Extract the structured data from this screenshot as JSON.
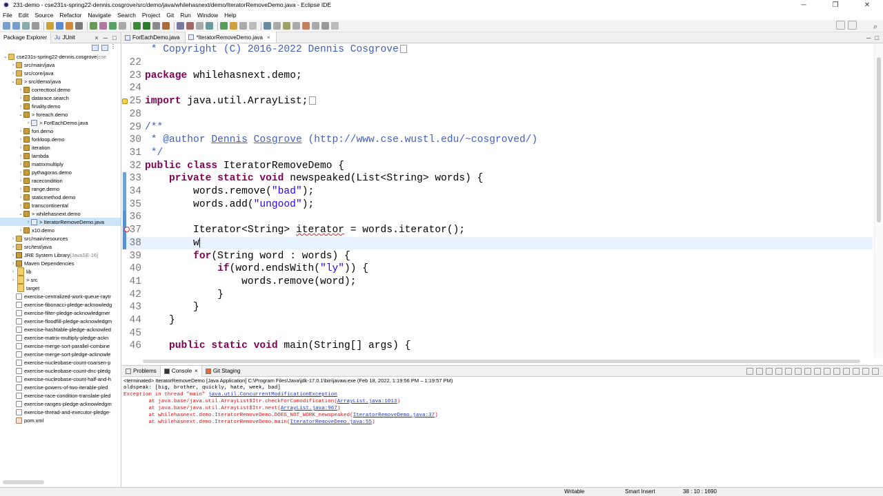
{
  "window": {
    "title": "231-demo - cse231s-spring22-dennis.cosgrove/src/demo/java/whilehasnext/demo/IteratorRemoveDemo.java - Eclipse IDE"
  },
  "menu": [
    "File",
    "Edit",
    "Source",
    "Refactor",
    "Navigate",
    "Search",
    "Project",
    "Git",
    "Run",
    "Window",
    "Help"
  ],
  "left_panel": {
    "tabs": [
      "Package Explorer",
      "JUnit"
    ],
    "tree": [
      {
        "indent": 0,
        "arrow": "⌄",
        "icon": "proj",
        "label": "cse231s-spring22-dennis.cosgrove",
        "dec": " [cse"
      },
      {
        "indent": 1,
        "arrow": "›",
        "icon": "srcf",
        "label": "src/main/java",
        "dec": ""
      },
      {
        "indent": 1,
        "arrow": "›",
        "icon": "srcf",
        "label": "src/core/java",
        "dec": ""
      },
      {
        "indent": 1,
        "arrow": "⌄",
        "icon": "srcf",
        "label": "> src/demo/java",
        "dec": ""
      },
      {
        "indent": 2,
        "arrow": "›",
        "icon": "pkg",
        "label": "correcttool.demo",
        "dec": ""
      },
      {
        "indent": 2,
        "arrow": "›",
        "icon": "pkg",
        "label": "datarace.search",
        "dec": ""
      },
      {
        "indent": 2,
        "arrow": "›",
        "icon": "pkg",
        "label": "finality.demo",
        "dec": ""
      },
      {
        "indent": 2,
        "arrow": "⌄",
        "icon": "pkg",
        "label": "> foreach.demo",
        "dec": ""
      },
      {
        "indent": 3,
        "arrow": "›",
        "icon": "java",
        "label": "> ForEachDemo.java",
        "dec": ""
      },
      {
        "indent": 2,
        "arrow": "›",
        "icon": "pkg",
        "label": "fori.demo",
        "dec": ""
      },
      {
        "indent": 2,
        "arrow": "›",
        "icon": "pkg",
        "label": "forkloop.demo",
        "dec": ""
      },
      {
        "indent": 2,
        "arrow": "›",
        "icon": "pkg",
        "label": "iteration",
        "dec": ""
      },
      {
        "indent": 2,
        "arrow": "›",
        "icon": "pkg",
        "label": "lambda",
        "dec": ""
      },
      {
        "indent": 2,
        "arrow": "›",
        "icon": "pkg",
        "label": "matrixmultiply",
        "dec": ""
      },
      {
        "indent": 2,
        "arrow": "›",
        "icon": "pkg",
        "label": "pythagoras.demo",
        "dec": ""
      },
      {
        "indent": 2,
        "arrow": "›",
        "icon": "pkg",
        "label": "racecondition",
        "dec": ""
      },
      {
        "indent": 2,
        "arrow": "›",
        "icon": "pkg",
        "label": "range.demo",
        "dec": ""
      },
      {
        "indent": 2,
        "arrow": "›",
        "icon": "pkg",
        "label": "staticmethod.demo",
        "dec": ""
      },
      {
        "indent": 2,
        "arrow": "›",
        "icon": "pkg",
        "label": "transcontinental",
        "dec": ""
      },
      {
        "indent": 2,
        "arrow": "⌄",
        "icon": "pkg",
        "label": "> whilehasnext.demo",
        "dec": ""
      },
      {
        "indent": 3,
        "arrow": "›",
        "icon": "java",
        "label": "> IteratorRemoveDemo.java",
        "dec": "",
        "sel": true
      },
      {
        "indent": 2,
        "arrow": "›",
        "icon": "pkg",
        "label": "x10.demo",
        "dec": ""
      },
      {
        "indent": 1,
        "arrow": "›",
        "icon": "srcf",
        "label": "src/main/resources",
        "dec": ""
      },
      {
        "indent": 1,
        "arrow": "›",
        "icon": "srcf",
        "label": "src/test/java",
        "dec": ""
      },
      {
        "indent": 1,
        "arrow": "›",
        "icon": "jar",
        "label": "JRE System Library",
        "dec": " [JavaSE-16]"
      },
      {
        "indent": 1,
        "arrow": "›",
        "icon": "jar",
        "label": "Maven Dependencies",
        "dec": ""
      },
      {
        "indent": 1,
        "arrow": "›",
        "icon": "fold",
        "label": "lib",
        "dec": ""
      },
      {
        "indent": 1,
        "arrow": "›",
        "icon": "fold",
        "label": "> src",
        "dec": ""
      },
      {
        "indent": 1,
        "arrow": "",
        "icon": "fold",
        "label": "target",
        "dec": ""
      },
      {
        "indent": 1,
        "arrow": "",
        "icon": "file",
        "label": "exercise-centralized-work-queue-raytr",
        "dec": ""
      },
      {
        "indent": 1,
        "arrow": "",
        "icon": "file",
        "label": "exercise-fibonacci-pledge-acknowledg",
        "dec": ""
      },
      {
        "indent": 1,
        "arrow": "",
        "icon": "file",
        "label": "exercise-filter-pledge-acknowledgmer",
        "dec": ""
      },
      {
        "indent": 1,
        "arrow": "",
        "icon": "file",
        "label": "exercise-floodfill-pledge-acknowledgm",
        "dec": ""
      },
      {
        "indent": 1,
        "arrow": "",
        "icon": "file",
        "label": "exercise-hashtable-pledge-acknowled",
        "dec": ""
      },
      {
        "indent": 1,
        "arrow": "",
        "icon": "file",
        "label": "exercise-matrix-multiply-pledge-ackn",
        "dec": ""
      },
      {
        "indent": 1,
        "arrow": "",
        "icon": "file",
        "label": "exercise-merge-sort-parallel-combine",
        "dec": ""
      },
      {
        "indent": 1,
        "arrow": "",
        "icon": "file",
        "label": "exercise-merge-sort-pledge-acknowle",
        "dec": ""
      },
      {
        "indent": 1,
        "arrow": "",
        "icon": "file",
        "label": "exercise-nucleobase-count-coarsen-p",
        "dec": ""
      },
      {
        "indent": 1,
        "arrow": "",
        "icon": "file",
        "label": "exercise-nucleobase-count-dnc-pledg",
        "dec": ""
      },
      {
        "indent": 1,
        "arrow": "",
        "icon": "file",
        "label": "exercise-nucleobase-count-half-and-h",
        "dec": ""
      },
      {
        "indent": 1,
        "arrow": "",
        "icon": "file",
        "label": "exercise-powers-of-two-iterable-pled",
        "dec": ""
      },
      {
        "indent": 1,
        "arrow": "",
        "icon": "file",
        "label": "exercise-race-condition-translate-pled",
        "dec": ""
      },
      {
        "indent": 1,
        "arrow": "",
        "icon": "file",
        "label": "exercise-ranges-pledge-acknowledgm",
        "dec": ""
      },
      {
        "indent": 1,
        "arrow": "",
        "icon": "file",
        "label": "exercise-thread-and-executor-pledge-",
        "dec": ""
      },
      {
        "indent": 1,
        "arrow": "",
        "icon": "xml",
        "label": "pom.xml",
        "dec": ""
      }
    ]
  },
  "editor": {
    "tabs": [
      "ForEachDemo.java",
      "*IteratorRemoveDemo.java"
    ],
    "lines": [
      {
        "num": "",
        "html": "<span class=\"cm\"> * Copyright (C) 2016-2022 Dennis Cosgrove</span><span class=\"fold\"></span>"
      },
      {
        "num": "22",
        "html": ""
      },
      {
        "num": "23",
        "html": "<span class=\"kw\">package</span> whilehasnext.demo;"
      },
      {
        "num": "24",
        "html": ""
      },
      {
        "num": "25",
        "html": "<span class=\"kw\">import</span> java.util.ArrayList;<span class=\"fold\"></span>"
      },
      {
        "num": "28",
        "html": ""
      },
      {
        "num": "29",
        "html": "<span class=\"cm\">/**</span>"
      },
      {
        "num": "30",
        "html": "<span class=\"cm\"> * @author <span class=\"cmu\">Dennis</span> <span class=\"cmu\">Cosgrove</span> (http://www.cse.wustl.edu/~cosgroved/)</span>"
      },
      {
        "num": "31",
        "html": "<span class=\"cm\"> */</span>"
      },
      {
        "num": "32",
        "html": "<span class=\"kw\">public class</span> IteratorRemoveDemo {"
      },
      {
        "num": "33",
        "html": "    <span class=\"kw\">private static void</span> newspeaked(List&lt;String&gt; words) {"
      },
      {
        "num": "34",
        "html": "        words.remove(<span class=\"str\">\"bad\"</span>);"
      },
      {
        "num": "35",
        "html": "        words.add(<span class=\"str\">\"ungood\"</span>);"
      },
      {
        "num": "36",
        "html": ""
      },
      {
        "num": "37",
        "html": "        Iterator&lt;String&gt; <span class=\"squig\">iterator</span> = words.iterator();"
      },
      {
        "num": "38",
        "html": "        w<span class=\"caret\"></span>",
        "cur": true
      },
      {
        "num": "39",
        "html": "        <span class=\"kw\">for</span>(String word : words) {"
      },
      {
        "num": "40",
        "html": "            <span class=\"kw\">if</span>(word.endsWith(<span class=\"str\">\"ly\"</span>)) {"
      },
      {
        "num": "41",
        "html": "                words.remove(word);"
      },
      {
        "num": "42",
        "html": "            }"
      },
      {
        "num": "43",
        "html": "        }"
      },
      {
        "num": "44",
        "html": "    }"
      },
      {
        "num": "45",
        "html": ""
      },
      {
        "num": "46",
        "html": "    <span class=\"kw\">public static void</span> main(String[] args) {"
      }
    ]
  },
  "bottom_panel": {
    "tabs": [
      "Problems",
      "Console",
      "Git Staging"
    ],
    "terminated": "<terminated> IteratorRemoveDemo [Java Application] C:\\Program Files\\Java\\jdk-17.0.1\\bin\\javaw.exe  (Feb 18, 2022, 1:19:56 PM – 1:19:57 PM)",
    "console": [
      {
        "cls": "",
        "html": "oldspeak: [big, brother, quickly, hate, week, bad]"
      },
      {
        "cls": "err",
        "html": "Exception in thread \"main\" <span class=\"lnk\">java.util.ConcurrentModificationException</span>"
      },
      {
        "cls": "err",
        "html": "\tat java.base/java.util.ArrayList$Itr.checkForComodification(<span class=\"lnk\">ArrayList.java:1013</span>)"
      },
      {
        "cls": "err",
        "html": "\tat java.base/java.util.ArrayList$Itr.next(<span class=\"lnk\">ArrayList.java:967</span>)"
      },
      {
        "cls": "err",
        "html": "\tat whilehasnext.demo.IteratorRemoveDemo.DOES_NOT_WORK_newspeaked(<span class=\"lnk\">IteratorRemoveDemo.java:37</span>)"
      },
      {
        "cls": "err",
        "html": "\tat whilehasnext.demo.IteratorRemoveDemo.main(<span class=\"lnk\">IteratorRemoveDemo.java:55</span>)"
      }
    ]
  },
  "status": {
    "writable": "Writable",
    "insert": "Smart Insert",
    "position": "38 : 10 : 1690"
  }
}
